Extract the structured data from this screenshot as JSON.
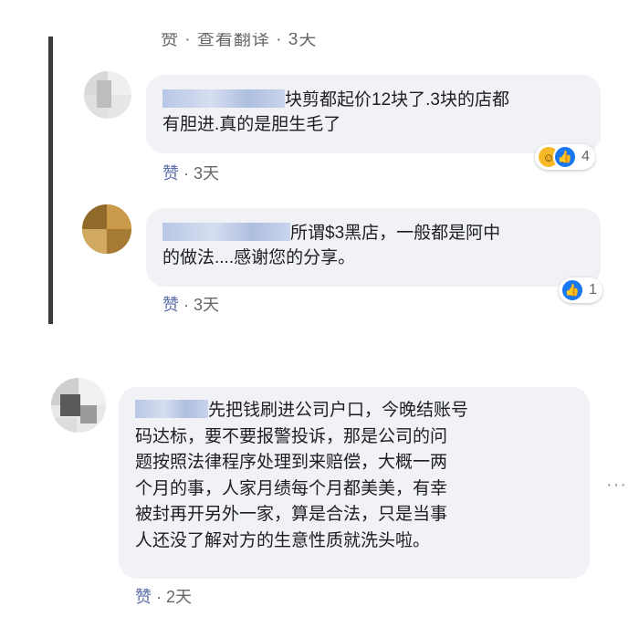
{
  "top_meta_partial": "赞 · 查看翻译 · 3天",
  "comments": [
    {
      "text_line1": "块剪都起价12块了.3块的店都",
      "text_line2": "有胆进.真的是胆生毛了",
      "like_label": "赞",
      "time": "3天",
      "reaction_count": "4"
    },
    {
      "text_line1": "所谓$3黑店，一般都是阿中",
      "text_line2": "的做法....感谢您的分享。",
      "like_label": "赞",
      "time": "3天",
      "reaction_count": "1"
    },
    {
      "text_line1": "先把钱刷进公司户口，今晚结账号",
      "lines": [
        "码达标，要不要报警投诉，那是公司的问",
        "题按照法律程序处理到来赔偿，大概一两",
        "个月的事，人家月绩每个月都美美，有幸",
        "被封再开另外一家，算是合法，只是当事",
        "人还没了解对方的生意性质就洗头啦。"
      ],
      "like_label": "赞",
      "time": "2天"
    }
  ],
  "more_label": "···",
  "icons": {
    "haha": "haha-reaction-icon",
    "like": "like-reaction-icon"
  },
  "colors": {
    "bubble": "#f0f2f5",
    "thread_line": "#3a3b3c",
    "like_blue": "#1877f2",
    "meta_text": "#65676b"
  }
}
